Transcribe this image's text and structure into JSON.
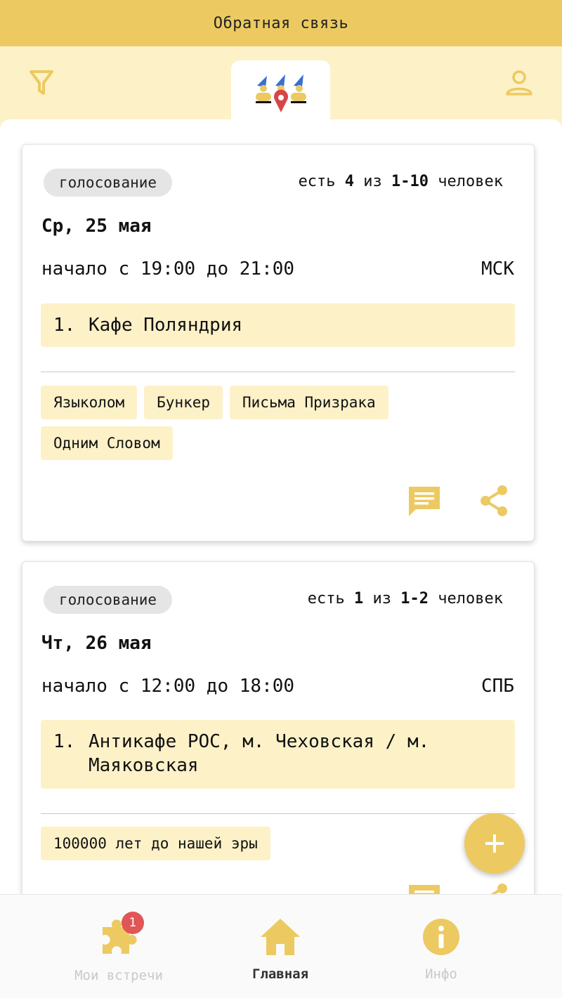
{
  "feedback": {
    "label": "Обратная связь"
  },
  "header": {
    "filter_icon": "filter-icon",
    "profile_icon": "profile-icon",
    "logo_icon": "app-logo"
  },
  "colors": {
    "accent": "#ecca61",
    "light_accent": "#fdf1c8",
    "badge": "#e05555"
  },
  "meetings": [
    {
      "status": "голосование",
      "participants_prefix": "есть",
      "participants_count": "4",
      "participants_mid": "из",
      "participants_range": "1-10",
      "participants_suffix": "человек",
      "date": "Ср, 25 мая",
      "time": "начало с 19:00 до 21:00",
      "timezone": "МСК",
      "location_num": "1.",
      "location": "Кафе Поляндрия",
      "games": [
        "Языколом",
        "Бункер",
        "Письма Призрака",
        "Одним Словом"
      ]
    },
    {
      "status": "голосование",
      "participants_prefix": "есть",
      "participants_count": "1",
      "participants_mid": "из",
      "participants_range": "1-2",
      "participants_suffix": "человек",
      "date": "Чт, 26 мая",
      "time": "начало с 12:00 до 18:00",
      "timezone": "СПБ",
      "location_num": "1.",
      "location": "Антикафе РОС, м. Чеховская / м. Маяковская",
      "games": [
        "100000 лет до нашей эры"
      ]
    }
  ],
  "fab": {
    "icon": "plus-icon"
  },
  "nav": [
    {
      "label": "Мои встречи",
      "icon": "puzzle-icon",
      "badge": "1"
    },
    {
      "label": "Главная",
      "icon": "home-icon"
    },
    {
      "label": "Инфо",
      "icon": "info-icon"
    }
  ]
}
